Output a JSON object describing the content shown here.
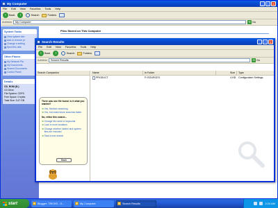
{
  "bg_window": {
    "title": "My Computer",
    "menu": [
      "File",
      "Edit",
      "View",
      "Favorites",
      "Tools",
      "Help"
    ],
    "toolbar": {
      "back": "Back",
      "search": "Search",
      "folders": "Folders"
    },
    "address": {
      "label": "Address",
      "value": "My Computer",
      "go": "Go"
    },
    "system_tasks": {
      "title": "System Tasks",
      "items": [
        "View system info",
        "Add or remove pr",
        "Change a setting",
        "Eject this disk"
      ]
    },
    "other_places": {
      "title": "Other Places",
      "items": [
        "My Network Pla",
        "My Documents",
        "Shared Documents",
        "Control Panel"
      ]
    },
    "details": {
      "title": "Details",
      "name": "CD_ROM (D:)",
      "type": "CD Drive",
      "fs": "File System: CDFS",
      "free": "Free Space: 0 bytes",
      "total": "Total Size: 3.47 GB"
    },
    "section_header": "Files Stored on This Computer"
  },
  "search_window": {
    "title": "Search Results",
    "menu": [
      "File",
      "Edit",
      "View",
      "Favorites",
      "Tools",
      "Help"
    ],
    "toolbar": {
      "back": "Back",
      "search": "Search",
      "folders": "Folders"
    },
    "address": {
      "label": "Address",
      "value": "Search Results",
      "go": "Go"
    },
    "companion": {
      "header": "Search Companion",
      "question": "There was one file found. Is it what you wanted?",
      "options_a": [
        "Yes, finished searching",
        "Yes, but make future searches faster"
      ],
      "refine_title": "No, refine this search...",
      "options_b": [
        "Change file name or keywords",
        "Look in more locations",
        "Change whether hidden and system files are included",
        "Start a new search"
      ],
      "back": "Back"
    },
    "columns": [
      "Name",
      "In Folder",
      "Size",
      "Type"
    ],
    "results": [
      {
        "name": "PRODUCT",
        "folder": "F:\\SOURCES",
        "size": "4 KB",
        "type": "Configuration Settings"
      }
    ]
  },
  "taskbar": {
    "start": "start",
    "tasks": [
      {
        "label": "Blogger: TRICKS - G...",
        "active": false
      },
      {
        "label": "My Computer",
        "active": false
      },
      {
        "label": "Search Results",
        "active": true
      }
    ],
    "clock": "2:24 AM"
  }
}
